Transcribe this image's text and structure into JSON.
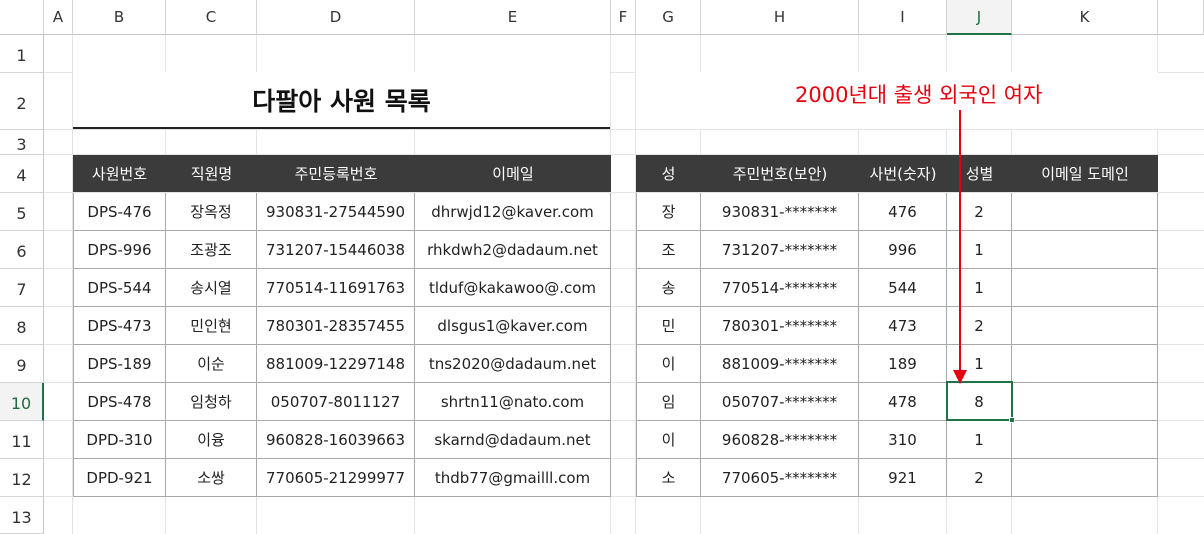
{
  "columns": [
    "A",
    "B",
    "C",
    "D",
    "E",
    "F",
    "G",
    "H",
    "I",
    "J",
    "K"
  ],
  "rows": [
    "1",
    "2",
    "3",
    "4",
    "5",
    "6",
    "7",
    "8",
    "9",
    "10",
    "11",
    "12",
    "13"
  ],
  "title": "다팔아 사원 목록",
  "annotation": "2000년대 출생 외국인 여자",
  "left_table": {
    "headers": [
      "사원번호",
      "직원명",
      "주민등록번호",
      "이메일"
    ],
    "rows": [
      [
        "DPS-476",
        "장옥정",
        "930831-27544590",
        "dhrwjd12@kaver.com"
      ],
      [
        "DPS-996",
        "조광조",
        "731207-15446038",
        "rhkdwh2@dadaum.net"
      ],
      [
        "DPS-544",
        "송시열",
        "770514-11691763",
        "tlduf@kakawoo@.com"
      ],
      [
        "DPS-473",
        "민인현",
        "780301-28357455",
        "dlsgus1@kaver.com"
      ],
      [
        "DPS-189",
        "이순",
        "881009-12297148",
        "tns2020@dadaum.net"
      ],
      [
        "DPS-478",
        "임청하",
        "050707-8011127",
        "shrtn11@nato.com"
      ],
      [
        "DPD-310",
        "이융",
        "960828-16039663",
        "skarnd@dadaum.net"
      ],
      [
        "DPD-921",
        "소쌍",
        "770605-21299977",
        "thdb77@gmailll.com"
      ]
    ]
  },
  "right_table": {
    "headers": [
      "성",
      "주민번호(보안)",
      "사번(숫자)",
      "성별",
      "이메일 도메인"
    ],
    "rows": [
      [
        "장",
        "930831-*******",
        "476",
        "2",
        ""
      ],
      [
        "조",
        "731207-*******",
        "996",
        "1",
        ""
      ],
      [
        "송",
        "770514-*******",
        "544",
        "1",
        ""
      ],
      [
        "민",
        "780301-*******",
        "473",
        "2",
        ""
      ],
      [
        "이",
        "881009-*******",
        "189",
        "1",
        ""
      ],
      [
        "임",
        "050707-*******",
        "478",
        "8",
        ""
      ],
      [
        "이",
        "960828-*******",
        "310",
        "1",
        ""
      ],
      [
        "소",
        "770605-*******",
        "921",
        "2",
        ""
      ]
    ]
  },
  "selected_cell": "J10",
  "colors": {
    "header_fill": "#3b3b3b",
    "annotation": "#e4000f",
    "selection": "#217346"
  }
}
